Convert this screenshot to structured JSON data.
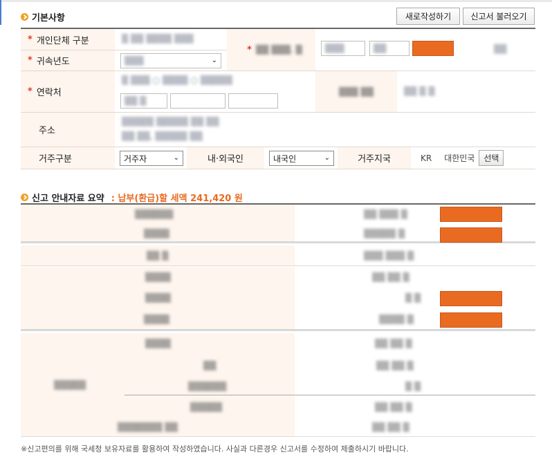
{
  "basic": {
    "title": "기본사항",
    "buttons": {
      "new": "새로작성하기",
      "load": "신고서 불러오기"
    },
    "labels": {
      "type": "개인단체 구분",
      "year": "귀속년도",
      "contact": "연락처",
      "address": "주소",
      "residence": "거주구분",
      "nationality": "내·외국인",
      "country": "거주지국"
    },
    "values": {
      "residence": "거주자",
      "nationality": "내국인",
      "country_code": "KR",
      "country_name": "대한민국",
      "select_btn": "선택"
    }
  },
  "summary": {
    "title": "신고 안내자료 요약",
    "tax_label": ": 납부(환급)할 세액 241,420 원"
  },
  "footnote": "※신고편의를 위해 국세청 보유자료를 활용하여 작성하였습니다. 사실과 다른경우 신고서를 수정하여 제출하시기 바랍니다.",
  "colors": {
    "accent": "#e96b21",
    "label_bg": "#fdf5ee",
    "required": "#e23c2a"
  }
}
